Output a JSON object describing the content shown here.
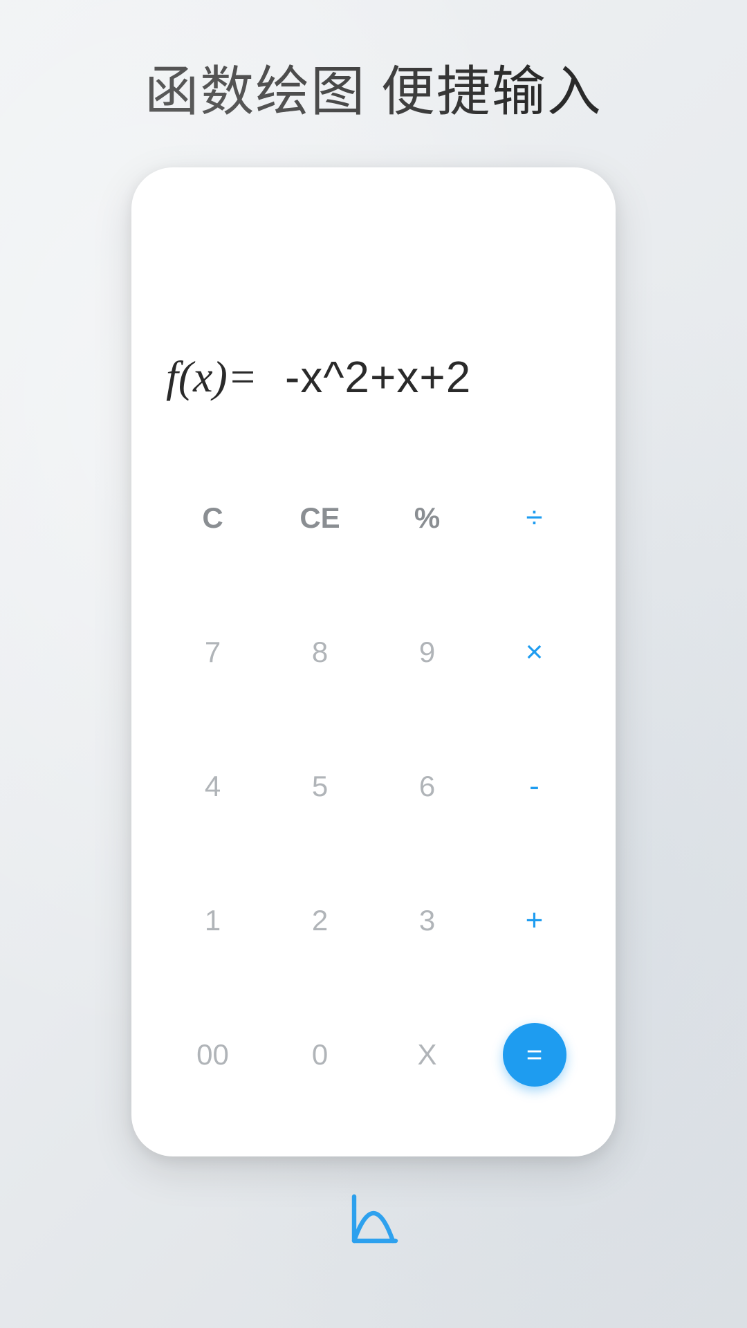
{
  "title": "函数绘图 便捷输入",
  "display": {
    "prefix": "f(x)=",
    "expression": "-x^2+x+2"
  },
  "keys": {
    "r0c0": "C",
    "r0c1": "CE",
    "r0c2": "%",
    "r0c3": "÷",
    "r1c0": "7",
    "r1c1": "8",
    "r1c2": "9",
    "r1c3": "×",
    "r2c0": "4",
    "r2c1": "5",
    "r2c2": "6",
    "r2c3": "-",
    "r3c0": "1",
    "r3c1": "2",
    "r3c2": "3",
    "r3c3": "+",
    "r4c0": "00",
    "r4c1": "0",
    "r4c2": "X",
    "equals": "="
  },
  "colors": {
    "accent": "#1e9cf0",
    "keyMuted": "#b0b4b8"
  }
}
